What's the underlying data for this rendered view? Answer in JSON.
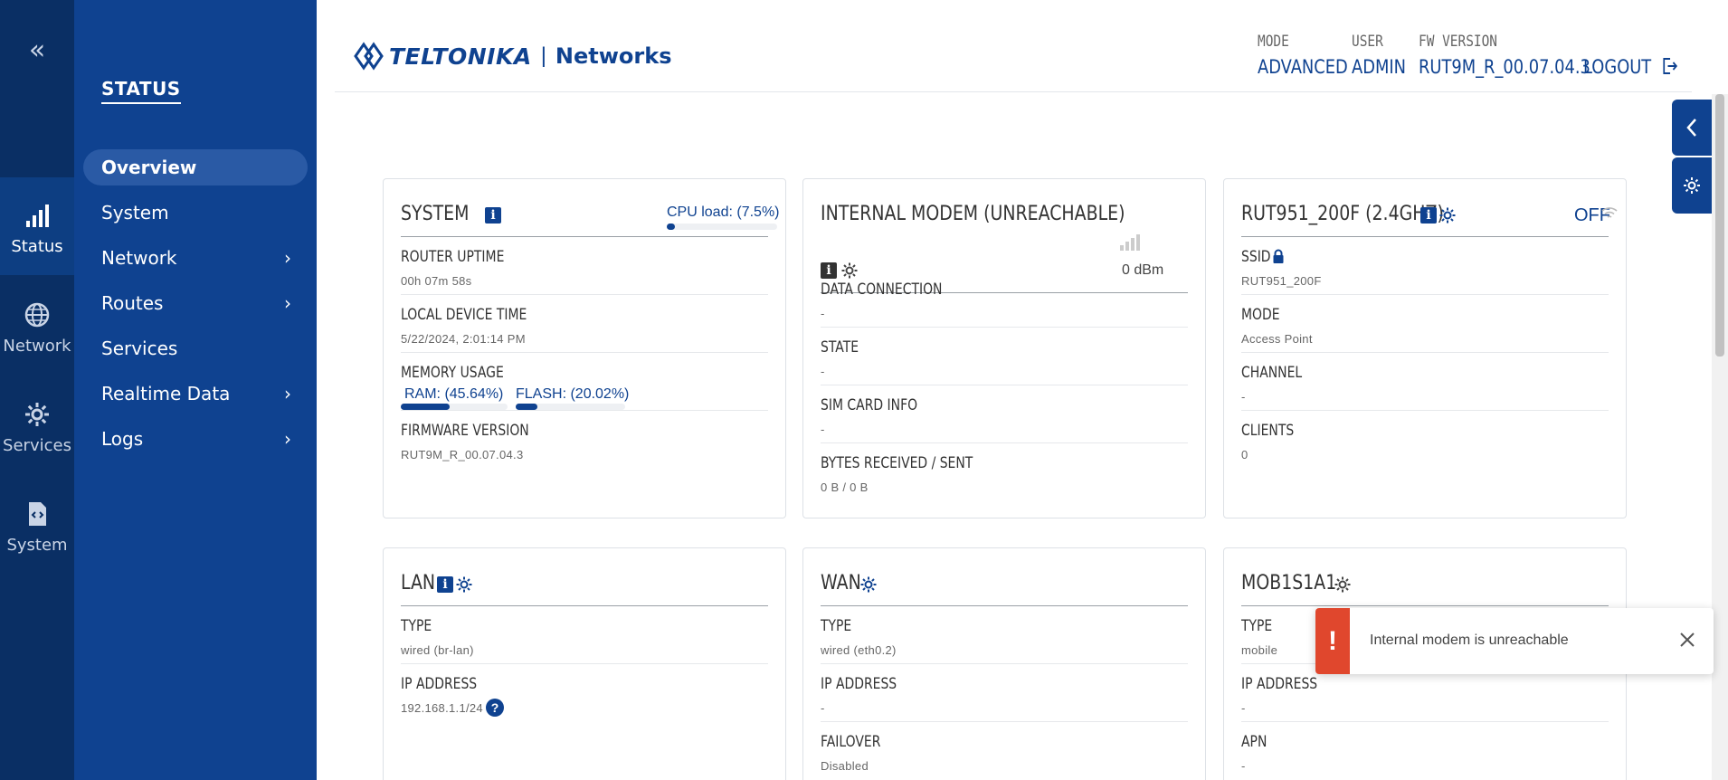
{
  "rail": {
    "collapse_label": "«",
    "items": [
      {
        "label": "Status",
        "icon": "signal-bars-icon"
      },
      {
        "label": "Network",
        "icon": "globe-icon"
      },
      {
        "label": "Services",
        "icon": "gear-icon"
      },
      {
        "label": "System",
        "icon": "code-file-icon"
      }
    ]
  },
  "menu": {
    "title": "STATUS",
    "items": [
      {
        "label": "Overview",
        "has_children": false
      },
      {
        "label": "System",
        "has_children": false
      },
      {
        "label": "Network",
        "has_children": true
      },
      {
        "label": "Routes",
        "has_children": true
      },
      {
        "label": "Services",
        "has_children": false
      },
      {
        "label": "Realtime Data",
        "has_children": true
      },
      {
        "label": "Logs",
        "has_children": true
      }
    ],
    "chevron": "›"
  },
  "header": {
    "logo_text": "TELTONIKA",
    "logo_suffix": "Networks",
    "logo_separator": "|",
    "mode_label": "MODE",
    "mode_value": "ADVANCED",
    "user_label": "USER",
    "user_value": "ADMIN",
    "fw_label": "FW VERSION",
    "fw_value": "RUT9M_R_00.07.04.3",
    "logout_label": "LOGOUT"
  },
  "system_card": {
    "title": "SYSTEM",
    "cpu_label": "CPU load: (7.5%)",
    "cpu_percent": 7.5,
    "uptime_label": "ROUTER UPTIME",
    "uptime_value": "00h 07m 58s",
    "time_label": "LOCAL DEVICE TIME",
    "time_value": "5/22/2024, 2:01:14 PM",
    "memory_label": "MEMORY USAGE",
    "ram_label": "RAM: (45.64%)",
    "ram_percent": 45.64,
    "flash_label": "FLASH: (20.02%)",
    "flash_percent": 20.02,
    "firmware_label": "FIRMWARE VERSION",
    "firmware_value": "RUT9M_R_00.07.04.3"
  },
  "modem_card": {
    "title": "INTERNAL MODEM (UNREACHABLE)",
    "signal_value": "0 dBm",
    "data_label": "DATA CONNECTION",
    "data_value": "-",
    "state_label": "STATE",
    "state_value": "-",
    "sim_label": "SIM CARD INFO",
    "sim_value": "-",
    "bytes_label": "BYTES RECEIVED / SENT",
    "bytes_value": "0 B / 0 B"
  },
  "wifi_card": {
    "title": "RUT951_200F (2.4GHZ)",
    "status": "OFF",
    "ssid_label": "SSID",
    "ssid_value": "RUT951_200F",
    "mode_label": "MODE",
    "mode_value": "Access Point",
    "channel_label": "CHANNEL",
    "channel_value": "-",
    "clients_label": "CLIENTS",
    "clients_value": "0"
  },
  "lan_card": {
    "title": "LAN",
    "type_label": "TYPE",
    "type_value": "wired (br-lan)",
    "ip_label": "IP ADDRESS",
    "ip_value": "192.168.1.1/24",
    "help": "?"
  },
  "wan_card": {
    "title": "WAN",
    "type_label": "TYPE",
    "type_value": "wired (eth0.2)",
    "ip_label": "IP ADDRESS",
    "ip_value": "-",
    "failover_label": "FAILOVER",
    "failover_value": "Disabled"
  },
  "mob_card": {
    "title": "MOB1S1A1",
    "type_label": "TYPE",
    "type_value": "mobile",
    "ip_label": "IP ADDRESS",
    "ip_value": "-",
    "apn_label": "APN",
    "apn_value": "-"
  },
  "toast": {
    "icon": "!",
    "message": "Internal modem is unreachable"
  },
  "info_glyph": "i",
  "colors": {
    "rail_bg": "#0a2f64",
    "menu_bg": "#0f4290",
    "accent": "#0f4290",
    "alert": "#e0472d"
  }
}
